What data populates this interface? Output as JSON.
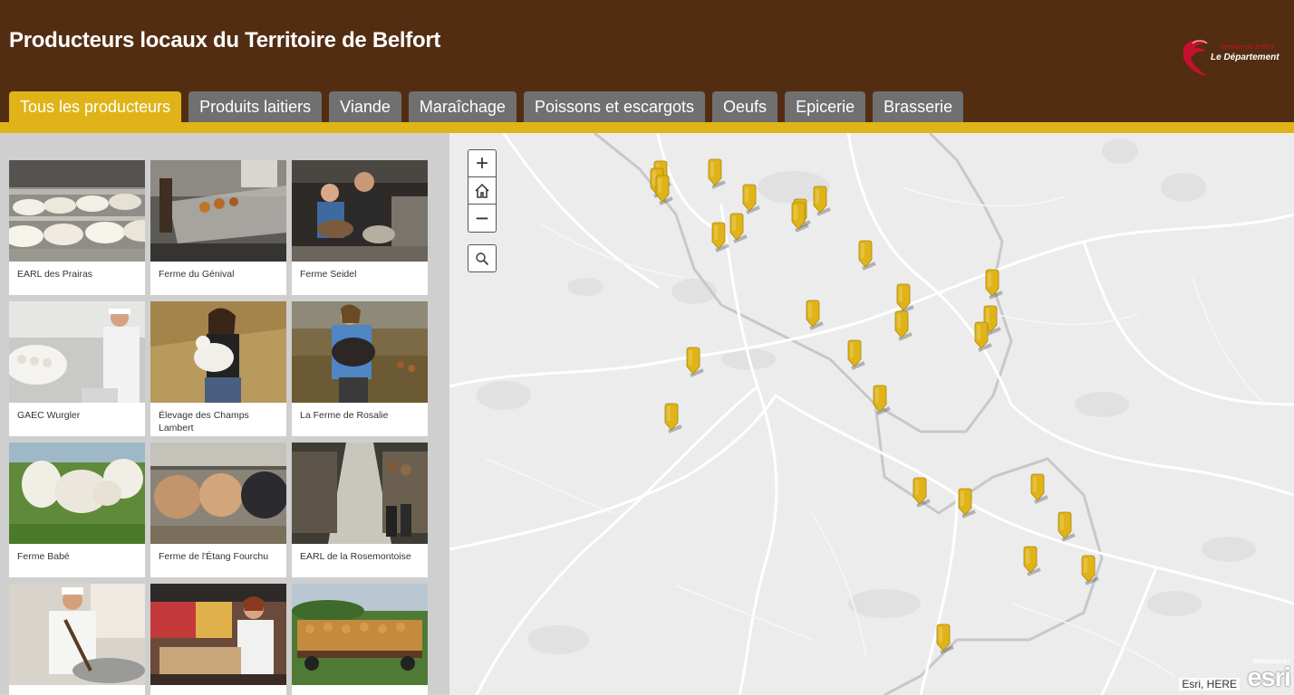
{
  "header": {
    "title": "Producteurs locaux du Territoire de Belfort",
    "logo": {
      "line1": "Territoire de Belfort",
      "line2": "Le Département"
    }
  },
  "tabs": [
    {
      "label": "Tous les producteurs",
      "active": true
    },
    {
      "label": "Produits laitiers"
    },
    {
      "label": "Viande"
    },
    {
      "label": "Maraîchage"
    },
    {
      "label": "Poissons et escargots"
    },
    {
      "label": "Oeufs"
    },
    {
      "label": "Epicerie"
    },
    {
      "label": "Brasserie"
    }
  ],
  "producers": [
    {
      "name": "EARL des Prairas",
      "photo": "cheese-rounds"
    },
    {
      "name": "Ferme du Génival",
      "photo": "shop-counter"
    },
    {
      "name": "Ferme Seidel",
      "photo": "goat-farmers"
    },
    {
      "name": "GAEC Wurgler",
      "photo": "cheesemaker"
    },
    {
      "name": "Élevage des Champs Lambert",
      "photo": "woman-lamb"
    },
    {
      "name": "La Ferme de Rosalie",
      "photo": "woman-pig"
    },
    {
      "name": "Ferme Babé",
      "photo": "white-cattle"
    },
    {
      "name": "Ferme de l'Étang Fourchu",
      "photo": "cattle-barn"
    },
    {
      "name": "EARL de la Rosemontoise",
      "photo": "cowshed"
    },
    {
      "name": "",
      "photo": "cook-pot"
    },
    {
      "name": "",
      "photo": "market-stall"
    },
    {
      "name": "",
      "photo": "potato-trailer"
    }
  ],
  "map": {
    "controls": {
      "zoom_in": "+",
      "zoom_out": "−"
    },
    "attribution": "Esri, HERE",
    "esri": {
      "powered": "POWERED BY",
      "word": "esri"
    },
    "marker_color": "#e0b418"
  }
}
